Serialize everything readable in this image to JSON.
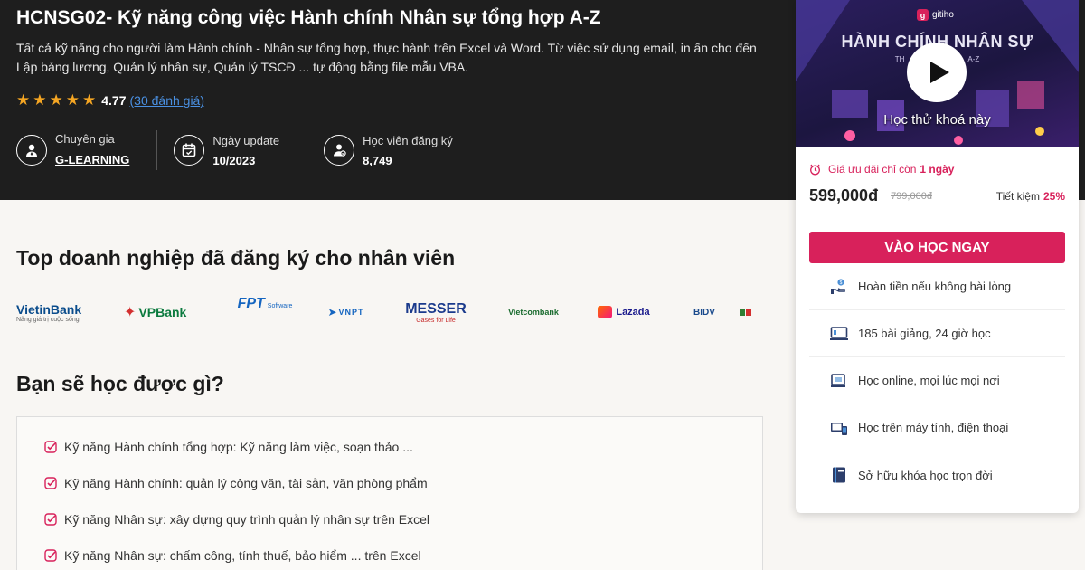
{
  "hero": {
    "title": "HCNSG02- Kỹ năng công việc Hành chính Nhân sự tổng hợp A-Z",
    "description": "Tất cả kỹ năng cho người làm Hành chính - Nhân sự tổng hợp, thực hành trên Excel và Word. Từ việc sử dụng email, in ấn cho đến Lập bảng lương, Quản lý nhân sự, Quản lý TSCĐ ... tự động bằng file mẫu VBA.",
    "rating": {
      "score": "4.77",
      "reviews": "(30 đánh giá)",
      "stars": 5
    },
    "meta": [
      {
        "label": "Chuyên gia",
        "value": "G-LEARNING",
        "icon": "expert-icon"
      },
      {
        "label": "Ngày update",
        "value": "10/2023",
        "icon": "calendar-icon"
      },
      {
        "label": "Học viên đăng ký",
        "value": "8,749",
        "icon": "students-icon"
      }
    ]
  },
  "companies": {
    "title": "Top doanh nghiệp đã đăng ký cho nhân viên",
    "logos": [
      {
        "name": "VietinBank",
        "sub": "Nâng giá trị cuộc sống",
        "color": "#0a4c8c"
      },
      {
        "name": "VPBank",
        "color": "#0b7a3e"
      },
      {
        "name": "FPT",
        "sub": "Software",
        "color": "#1565c0"
      },
      {
        "name": "VNPT",
        "color": "#1565c0"
      },
      {
        "name": "MESSER",
        "sub": "Gases for Life",
        "color": "#1a3a8c"
      },
      {
        "name": "Vietcombank",
        "color": "#1a6b2e"
      },
      {
        "name": "Lazada",
        "color": "#1a1a8c"
      },
      {
        "name": "BIDV",
        "color": "#1a4a8c"
      }
    ]
  },
  "learn": {
    "title": "Bạn sẽ học được gì?",
    "items": [
      "Kỹ năng Hành chính tổng hợp: Kỹ năng làm việc, soạn thảo ...",
      "Kỹ năng Hành chính: quản lý công văn, tài sản, văn phòng phẩm",
      "Kỹ năng Nhân sự: xây dựng quy trình quản lý nhân sự trên Excel",
      "Kỹ năng Nhân sự: chấm công, tính thuế, bảo hiểm ... trên Excel"
    ]
  },
  "card": {
    "brand": "gitiho",
    "thumb_title": "HÀNH CHÍNH NHÂN SỰ",
    "thumb_sub_left": "TH",
    "thumb_sub_right": "A-Z",
    "thumb_caption": "Học thử khoá này",
    "promo_text": "Giá ưu đãi chỉ còn",
    "promo_days": "1 ngày",
    "price": "599,000đ",
    "old_price": "799,000đ",
    "save_label": "Tiết kiệm",
    "save_pct": "25%",
    "cta": "VÀO HỌC NGAY",
    "accent": "#d8215b",
    "features": [
      {
        "text": "Hoàn tiền nếu không hài lòng",
        "icon": "refund-icon"
      },
      {
        "text": "185 bài giảng, 24 giờ học",
        "icon": "lectures-icon"
      },
      {
        "text": "Học online, mọi lúc mọi nơi",
        "icon": "online-icon"
      },
      {
        "text": "Học trên máy tính, điện thoại",
        "icon": "devices-icon"
      },
      {
        "text": "Sở hữu khóa học trọn đời",
        "icon": "lifetime-icon"
      }
    ]
  }
}
